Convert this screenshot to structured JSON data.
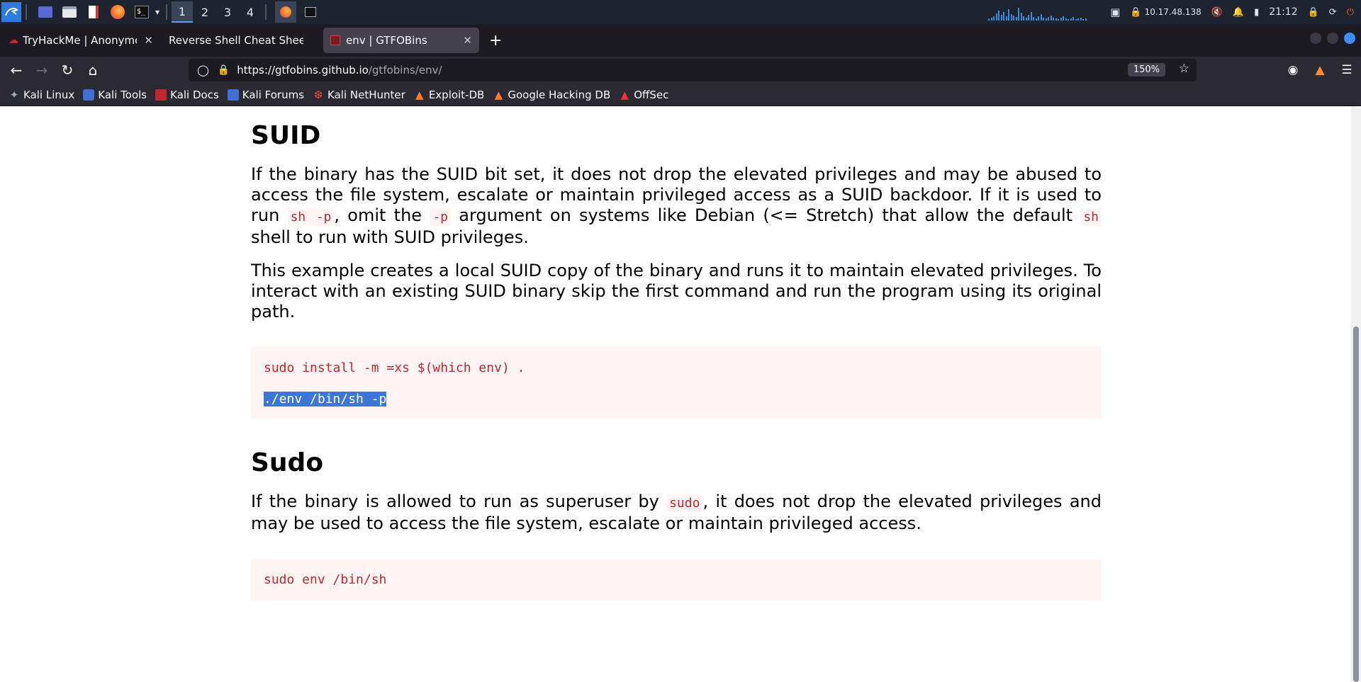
{
  "taskbar": {
    "workspaces": [
      "1",
      "2",
      "3",
      "4"
    ],
    "ip": "10.17.48.138",
    "time": "21:12"
  },
  "tabs": [
    {
      "title": "TryHackMe | Anonymous"
    },
    {
      "title": "Reverse Shell Cheat Sheet | p"
    },
    {
      "title": "env | GTFOBins"
    }
  ],
  "navbar": {
    "url_host": "https://gtfobins.github.io",
    "url_path": "/gtfobins/env/",
    "zoom": "150%"
  },
  "bookmarks": [
    "Kali Linux",
    "Kali Tools",
    "Kali Docs",
    "Kali Forums",
    "Kali NetHunter",
    "Exploit-DB",
    "Google Hacking DB",
    "OffSec"
  ],
  "colors": {
    "accent": "#3f8cff",
    "code_red": "#c0282d",
    "code_bg": "#fff4f4"
  },
  "suid": {
    "heading": "SUID",
    "p1_a": "If the binary has the SUID bit set, it does not drop the elevated privileges and may be abused to access the file system, escalate or maintain privileged access as a SUID backdoor. If it is used to run ",
    "p1_code1": "sh -p",
    "p1_b": ", omit the ",
    "p1_code2": "-p",
    "p1_c": " argument on systems like Debian (<= Stretch) that allow the default ",
    "p1_code3": "sh",
    "p1_d": " shell to run with SUID privileges.",
    "p2": "This example creates a local SUID copy of the binary and runs it to maintain elevated privileges. To interact with an existing SUID binary skip the first command and run the program using its original path.",
    "code_line1": "sudo install -m =xs $(which env) .",
    "code_line2": "./env /bin/sh -p"
  },
  "sudo": {
    "heading": "Sudo",
    "p1_a": "If the binary is allowed to run as superuser by ",
    "p1_code": "sudo",
    "p1_b": ", it does not drop the elevated privileges and may be used to access the file system, escalate or maintain privileged access.",
    "code_line1": "sudo env /bin/sh"
  }
}
